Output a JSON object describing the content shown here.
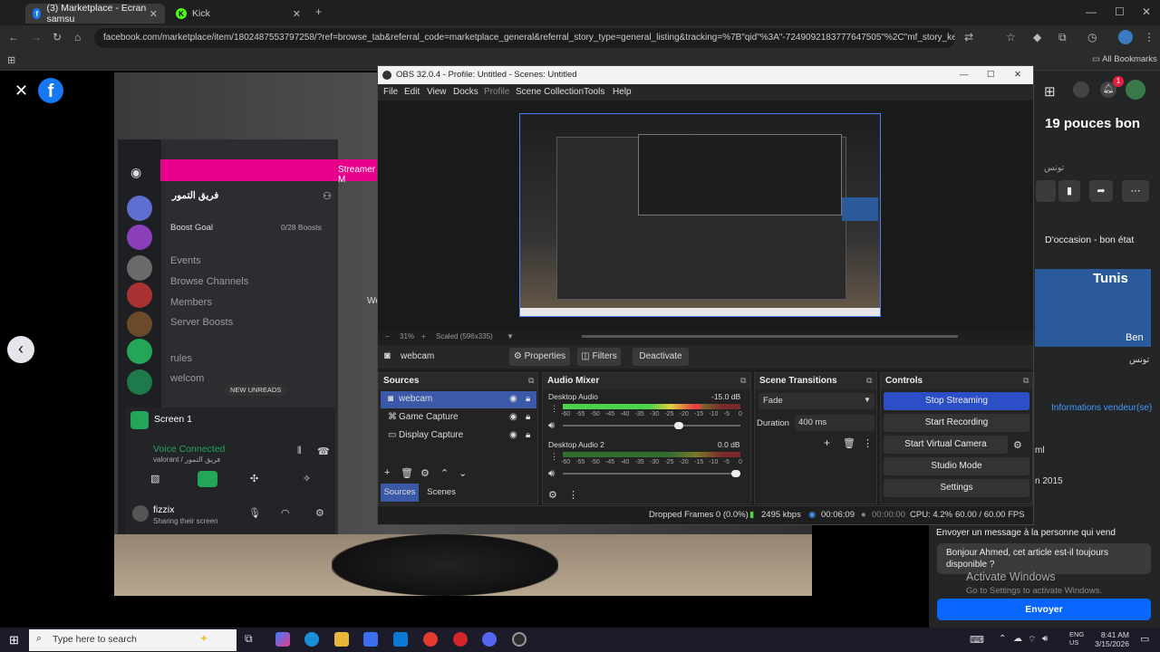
{
  "browser": {
    "tabs": [
      {
        "label": "(3) Marketplace - Ecran samsu",
        "active": true
      },
      {
        "label": "Kick",
        "active": false
      }
    ],
    "url": "facebook.com/marketplace/item/1802487553797258/?ref=browse_tab&referral_code=marketplace_general&referral_story_type=general_listing&tracking=%7B\"qid\"%3A\"-7249092183777647505\"%2C\"mf_story_key\"%3A\"642...",
    "bookmarks_label": "All Bookmarks"
  },
  "facebook": {
    "listing_title": "19 pouces bon",
    "city_ar": "تونس",
    "condition": "D'occasion - bon état",
    "map_city": "Tunis",
    "map_sub": "Ben",
    "map_ar": "تونس",
    "seller_info": "Informations vendeur(se)",
    "joined_partial": "ml",
    "year_partial": "n 2015",
    "message_header": "Envoyer un message à la personne qui vend",
    "message_text": "Bonjour Ahmed, cet article est-il toujours disponible ?",
    "send_label": "Envoyer",
    "notification_count": "1",
    "activate_title": "Activate Windows",
    "activate_sub": "Go to Settings to activate Windows."
  },
  "discord": {
    "server_name": "فريق التمور",
    "streamer_label": "Streamer M",
    "boost_goal": "Boost Goal",
    "boost_count": "0/28 Boosts",
    "menu": [
      "Events",
      "Browse Channels",
      "Members",
      "Server Boosts"
    ],
    "channels": [
      "rules",
      "welcom"
    ],
    "new_unreads": "NEW UNREADS",
    "screen_label": "Screen 1",
    "voice_connected": "Voice Connected",
    "voice_sub": "valorant / فريق التمور",
    "user": "fizzix",
    "user_status": "Sharing their screen",
    "partial_we": "We"
  },
  "obs": {
    "title": "OBS 32.0.4 - Profile: Untitled - Scenes: Untitled",
    "menu": [
      "File",
      "Edit",
      "View",
      "Docks",
      "Profile",
      "Scene Collection",
      "Tools",
      "Help"
    ],
    "zoom": "31%",
    "scaled": "Scaled (596x335)",
    "selected_source": "webcam",
    "buttons": {
      "properties": "Properties",
      "filters": "Filters",
      "deactivate": "Deactivate"
    },
    "docks": {
      "sources": "Sources",
      "audio": "Audio Mixer",
      "transitions": "Scene Transitions",
      "controls": "Controls"
    },
    "sources": [
      "webcam",
      "Game Capture",
      "Display Capture"
    ],
    "source_tabs": [
      "Sources",
      "Scenes"
    ],
    "audio": [
      {
        "name": "Desktop Audio",
        "db": "-15.0 dB",
        "level": 0.78,
        "volume": 0.66
      },
      {
        "name": "Desktop Audio 2",
        "db": "0.0 dB",
        "level": 0.0,
        "volume": 1.0
      }
    ],
    "meter_ticks": [
      "-60",
      "-55",
      "-50",
      "-45",
      "-40",
      "-35",
      "-30",
      "-25",
      "-20",
      "-15",
      "-10",
      "-5",
      "0"
    ],
    "transition": "Fade",
    "duration_label": "Duration",
    "duration_value": "400 ms",
    "controls": [
      "Stop Streaming",
      "Start Recording",
      "Start Virtual Camera",
      "Studio Mode",
      "Settings"
    ],
    "status": {
      "dropped": "Dropped Frames 0 (0.0%)",
      "kbps": "2495 kbps",
      "stream_time": "00:06:09",
      "rec_time": "00:00:00",
      "cpu": "CPU: 4.2%",
      "fps": "60.00 / 60.00 FPS"
    }
  },
  "taskbar": {
    "search_placeholder": "Type here to search",
    "lang1": "ENG",
    "lang2": "US",
    "time": "8:41 AM",
    "date": "3/15/2026"
  },
  "colors": {
    "obs_accent": "#3a5aa8",
    "stream_button": "#2c4fc7",
    "facebook_blue": "#0866ff",
    "discord_bg": "#2b2d31"
  }
}
